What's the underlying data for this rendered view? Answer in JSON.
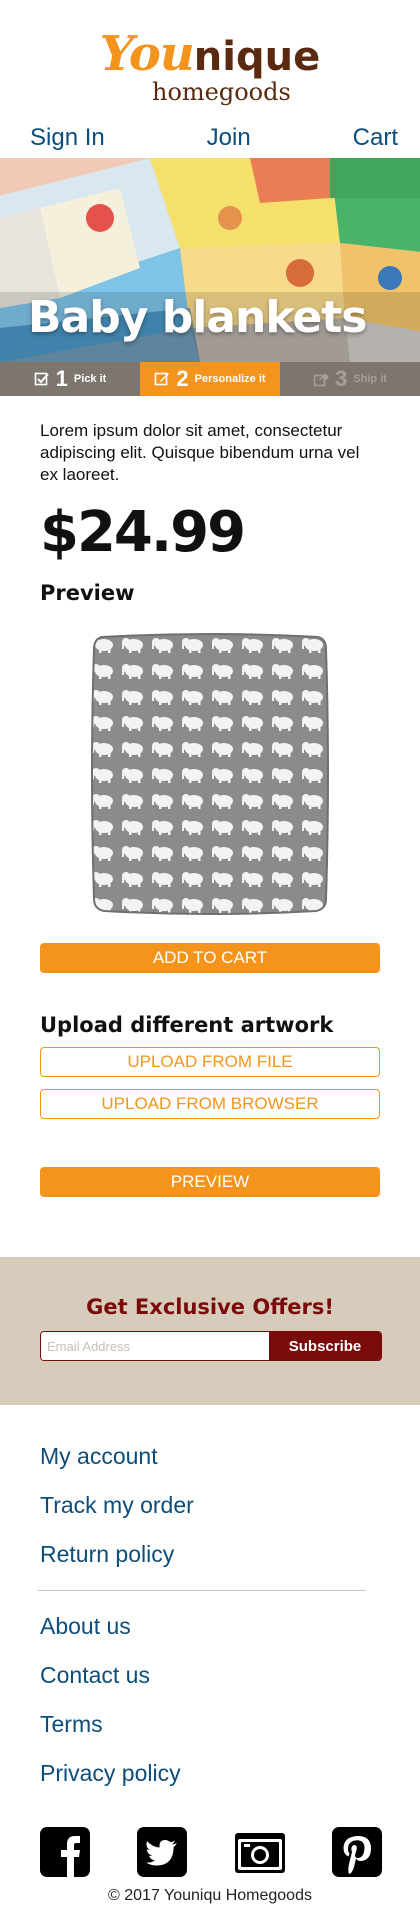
{
  "brand": {
    "logo_you": "You",
    "logo_nique": "nique",
    "logo_home": "homegoods"
  },
  "nav": {
    "sign_in": "Sign In",
    "join": "Join",
    "cart": "Cart"
  },
  "hero": {
    "title": "Baby blankets"
  },
  "steps": [
    {
      "num": "1",
      "label": "Pick it"
    },
    {
      "num": "2",
      "label": "Personalize it"
    },
    {
      "num": "3",
      "label": "Ship it"
    }
  ],
  "product": {
    "description": "Lorem ipsum dolor sit amet, consectetur adipiscing elit. Quisque bibendum urna vel ex laoreet.",
    "price": "$24.99",
    "preview_heading": "Preview",
    "add_to_cart": "ADD TO CART",
    "upload_heading": "Upload different artwork",
    "upload_file": "UPLOAD FROM FILE",
    "upload_browser": "UPLOAD FROM BROWSER",
    "preview_button": "PREVIEW"
  },
  "offers": {
    "title": "Get Exclusive Offers!",
    "email_placeholder": "Email Address",
    "subscribe": "Subscribe"
  },
  "footer": {
    "links_top": [
      "My account",
      "Track my order",
      "Return policy"
    ],
    "links_bottom": [
      "About us",
      "Contact us",
      "Terms",
      "Privacy policy"
    ],
    "social": [
      "facebook-icon",
      "twitter-icon",
      "camera-icon",
      "pinterest-icon"
    ],
    "copyright": "© 2017 Youniqu Homegoods"
  },
  "colors": {
    "accent": "#f4941c",
    "brand_brown": "#5a2a10",
    "link_blue": "#0c4d7a",
    "offer_red": "#7a0b0b",
    "offer_bg": "#d7ccbc",
    "step_bg": "#7d766f"
  }
}
